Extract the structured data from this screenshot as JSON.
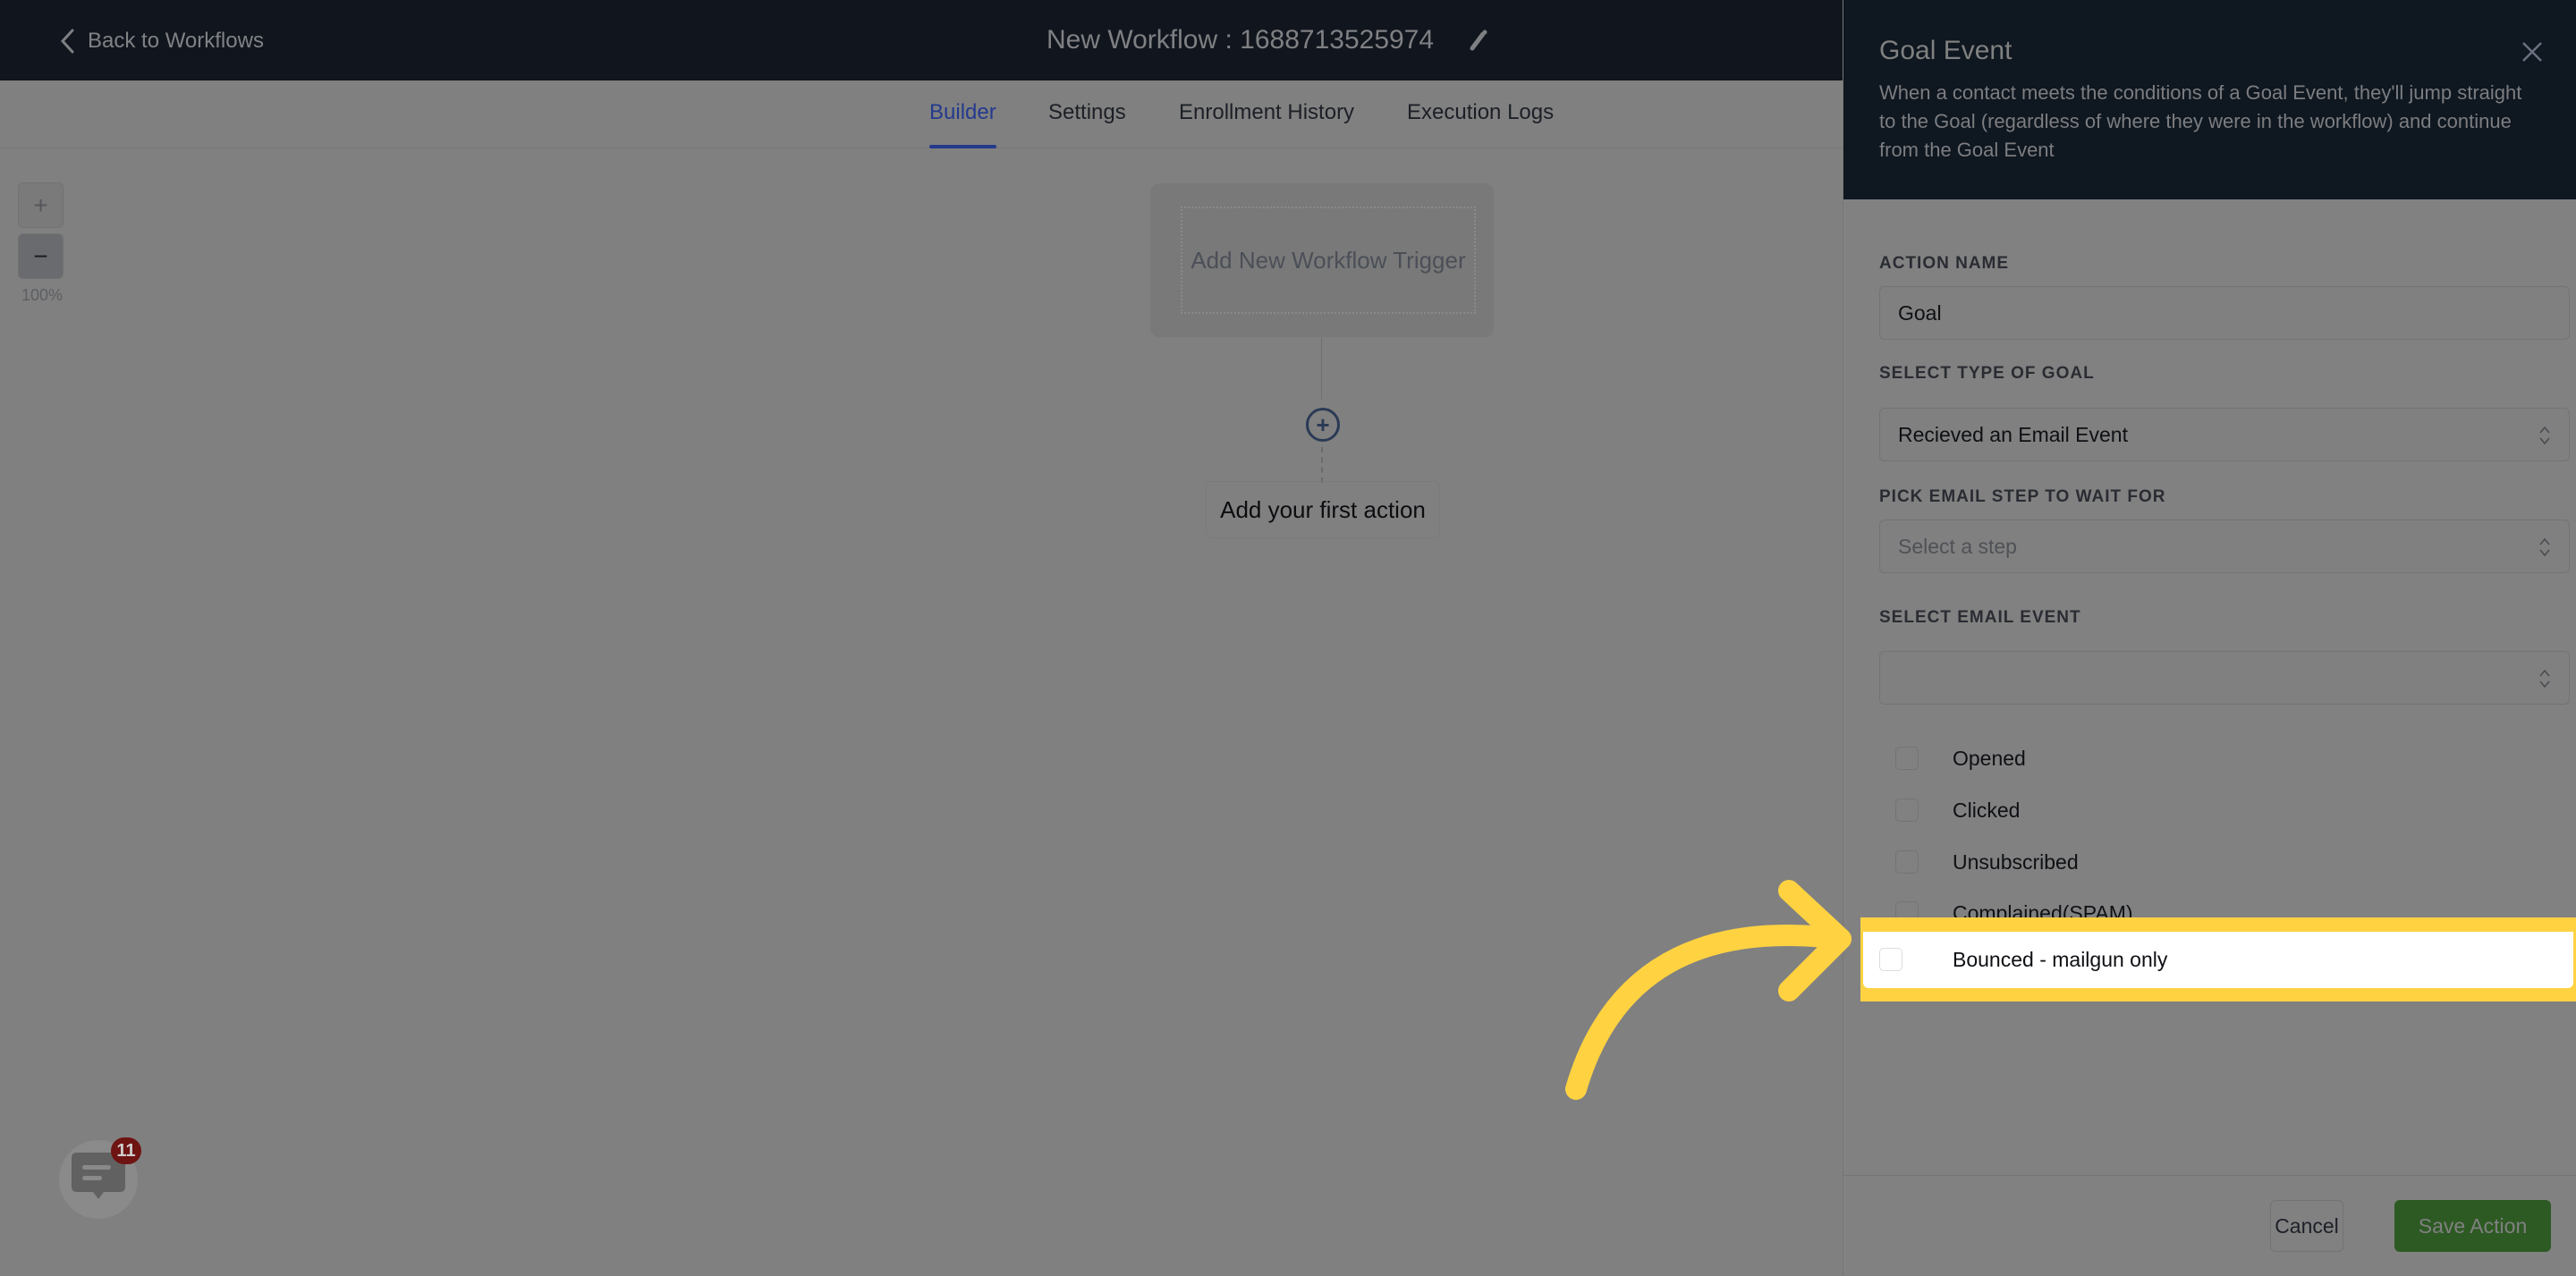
{
  "topbar": {
    "back_label": "Back to Workflows",
    "workflow_title": "New Workflow : 1688713525974"
  },
  "tabs": [
    {
      "label": "Builder",
      "active": true
    },
    {
      "label": "Settings",
      "active": false
    },
    {
      "label": "Enrollment History",
      "active": false
    },
    {
      "label": "Execution Logs",
      "active": false
    }
  ],
  "zoom": {
    "plus": "+",
    "minus": "−",
    "level": "100%"
  },
  "canvas": {
    "trigger_label": "Add New Workflow Trigger",
    "add_icon": "+",
    "first_action_label": "Add your first action"
  },
  "chat": {
    "badge_count": "11"
  },
  "panel": {
    "title": "Goal Event",
    "description": "When a contact meets the conditions of a Goal Event, they'll jump straight to the Goal (regardless of where they were in the workflow) and continue from the Goal Event",
    "fields": {
      "action_name": {
        "label": "ACTION NAME",
        "value": "Goal"
      },
      "goal_type": {
        "label": "SELECT TYPE OF GOAL",
        "value": "Recieved an Email Event"
      },
      "email_step": {
        "label": "PICK EMAIL STEP TO WAIT FOR",
        "placeholder": "Select a step"
      },
      "email_event": {
        "label": "SELECT EMAIL EVENT",
        "value": ""
      }
    },
    "email_event_options": [
      {
        "label": "Opened",
        "checked": false
      },
      {
        "label": "Clicked",
        "checked": false
      },
      {
        "label": "Unsubscribed",
        "checked": false
      },
      {
        "label": "Complained(SPAM)",
        "checked": false
      },
      {
        "label": "Bounced - mailgun only",
        "checked": false,
        "highlighted": true
      }
    ],
    "cancel_label": "Cancel",
    "save_label": "Save Action"
  },
  "colors": {
    "highlight": "#ffd242",
    "active_tab": "#243a8c",
    "save_button": "#2d5a23",
    "badge": "#6e1412"
  }
}
